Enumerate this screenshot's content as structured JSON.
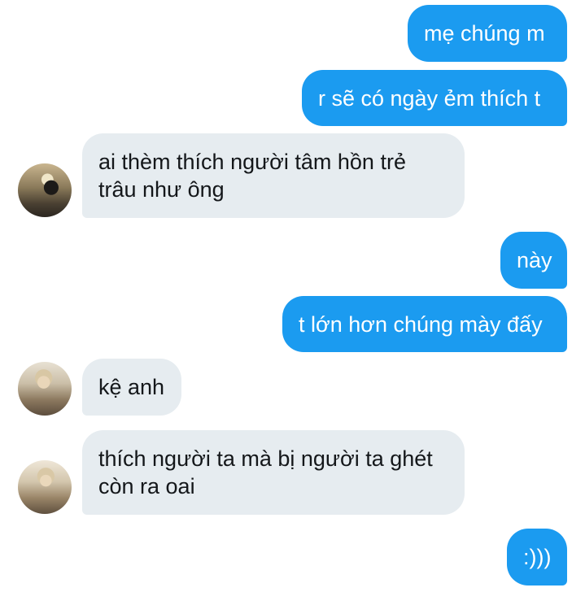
{
  "conversation": {
    "messages": [
      {
        "direction": "outgoing",
        "lines": [
          "mẹ chúng m"
        ]
      },
      {
        "direction": "outgoing",
        "lines": [
          "r sẽ có ngày ẻm thích t"
        ]
      },
      {
        "direction": "incoming",
        "lines": [
          "ai thèm thích người tâm hồn trẻ",
          "trâu như ông"
        ]
      },
      {
        "direction": "outgoing",
        "lines": [
          "này"
        ]
      },
      {
        "direction": "outgoing",
        "lines": [
          "t lớn hơn chúng mày đấy"
        ]
      },
      {
        "direction": "incoming",
        "lines": [
          "kệ anh"
        ]
      },
      {
        "direction": "incoming",
        "lines": [
          "thích người ta mà bị người ta ghét",
          "còn ra oai"
        ]
      },
      {
        "direction": "outgoing",
        "lines": [
          ":)))"
        ]
      }
    ]
  },
  "colors": {
    "outgoing_bubble": "#1b9bf0",
    "incoming_bubble": "#e6ecf0",
    "outgoing_text": "#ffffff",
    "incoming_text": "#14171a"
  }
}
